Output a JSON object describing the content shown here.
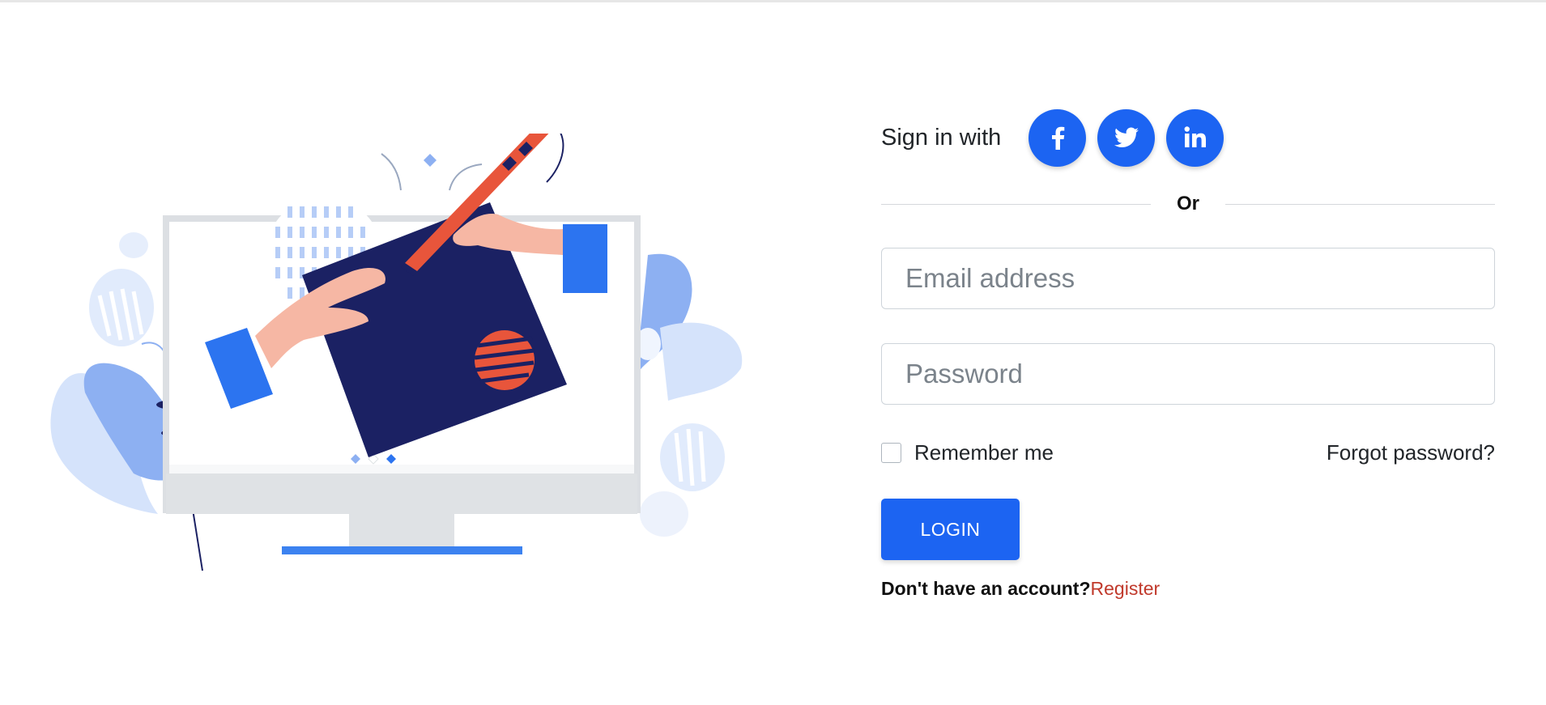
{
  "social": {
    "label": "Sign in with",
    "buttons": [
      {
        "name": "facebook",
        "glyph": "f"
      },
      {
        "name": "twitter",
        "glyph": "twitter-bird"
      },
      {
        "name": "linkedin",
        "glyph": "in"
      }
    ]
  },
  "divider": {
    "label": "Or"
  },
  "form": {
    "email_placeholder": "Email address",
    "password_placeholder": "Password",
    "remember_label": "Remember me",
    "forgot_label": "Forgot password?",
    "login_label": "LOGIN",
    "no_account_label": "Don't have an account?",
    "register_label": "Register"
  },
  "colors": {
    "accent": "#1c64f2",
    "register_link": "#c0392b",
    "illustration_navy": "#1b2163",
    "illustration_orange": "#e8553b"
  },
  "illustration": {
    "name": "computer-drawing-illustration"
  }
}
